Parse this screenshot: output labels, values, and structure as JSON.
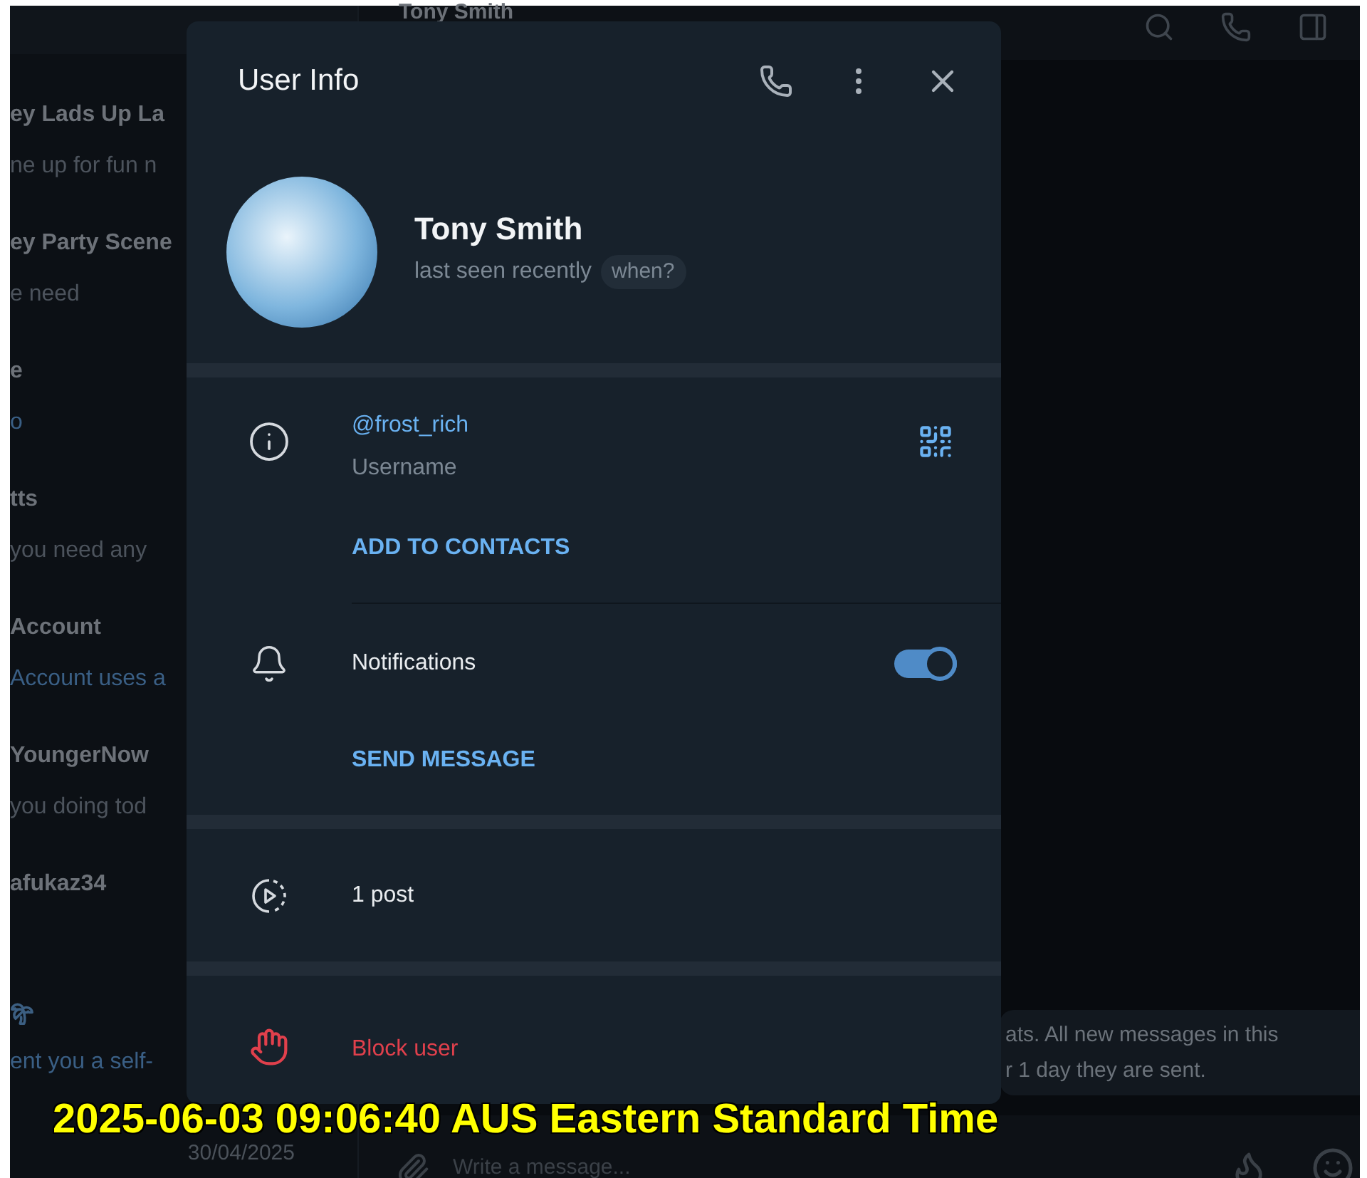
{
  "chat_list": {
    "items": [
      {
        "kind": "text",
        "title": "ey Lads Up La",
        "preview": "ne up for fun n",
        "accent": false
      },
      {
        "kind": "text",
        "title": "ey Party Scene",
        "preview": "e need",
        "accent": false
      },
      {
        "kind": "text",
        "title": "e",
        "preview": "o",
        "accent": true
      },
      {
        "kind": "text",
        "title": "tts",
        "preview": "you need any",
        "accent": false
      },
      {
        "kind": "text",
        "title": "Account",
        "preview": "Account uses a",
        "accent": true
      },
      {
        "kind": "text",
        "title": "YoungerNow",
        "preview": "you doing tod",
        "accent": false
      },
      {
        "kind": "text",
        "title": "afukaz34",
        "accent": false
      },
      {
        "kind": "icon",
        "preview": "ent you a self-",
        "accent": true
      }
    ],
    "date": "30/04/2025"
  },
  "chat_header": {
    "title": "Tony Smith"
  },
  "message": {
    "lines": [
      "ats. All new messages in this",
      "r 1 day they are sent."
    ]
  },
  "composer": {
    "placeholder": "Write a message..."
  },
  "dialog": {
    "title": "User Info",
    "name": "Tony Smith",
    "status": "last seen recently",
    "status_button": "when?",
    "username": "@frost_rich",
    "username_label": "Username",
    "add_contacts": "ADD TO CONTACTS",
    "notifications": {
      "label": "Notifications",
      "on": true
    },
    "send_message": "SEND MESSAGE",
    "posts": "1 post",
    "block": "Block user"
  },
  "timestamp_overlay": "2025-06-03 09:06:40 AUS Eastern Standard Time"
}
